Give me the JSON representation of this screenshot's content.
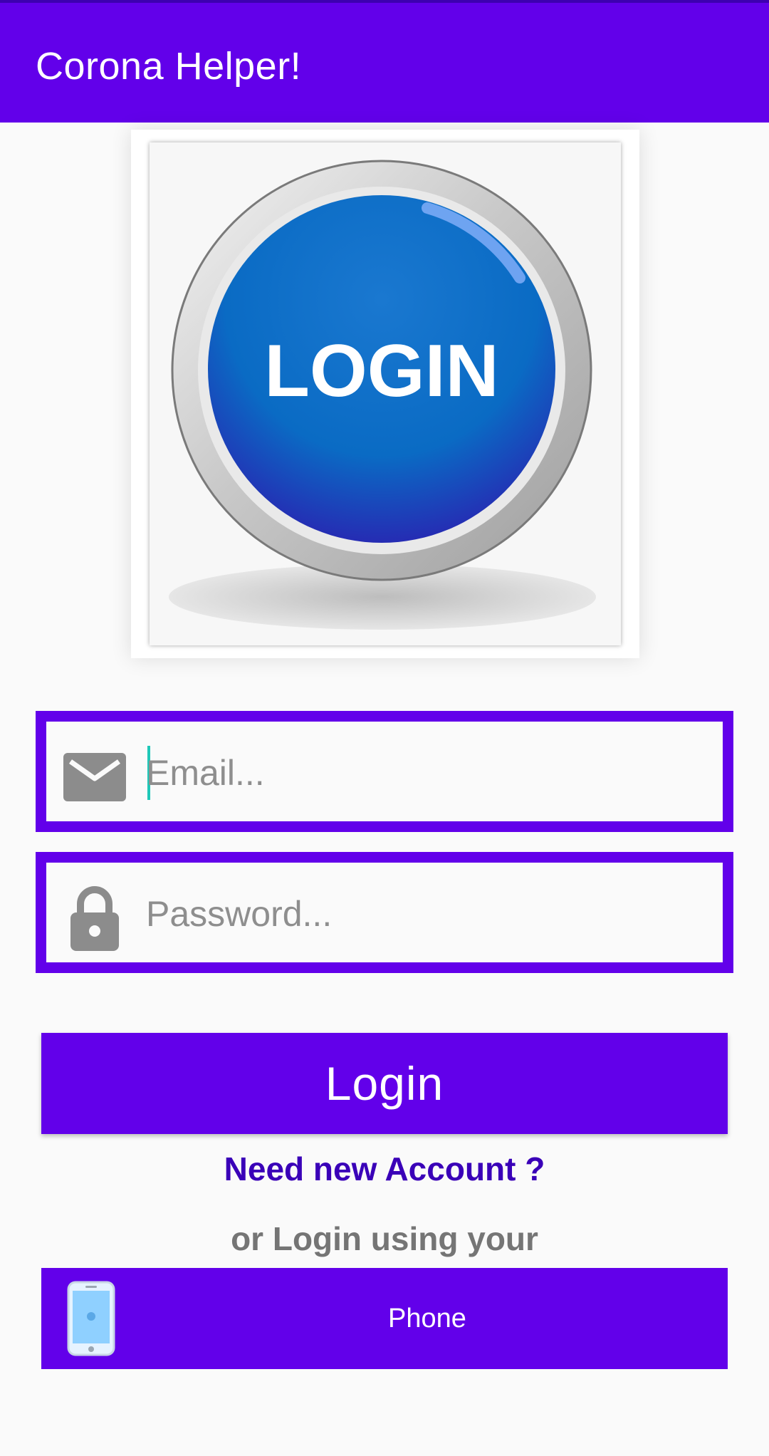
{
  "app_bar": {
    "title": "Corona Helper!"
  },
  "hero": {
    "image_text": "LOGIN"
  },
  "email_field": {
    "placeholder": "Email...",
    "value": "",
    "icon": "mail-icon"
  },
  "password_field": {
    "placeholder": "Password...",
    "value": "",
    "icon": "lock-icon"
  },
  "login_button": {
    "label": "Login"
  },
  "links": {
    "new_account": "Need new Account ?",
    "or_login": "or Login using your"
  },
  "phone_button": {
    "label": "Phone",
    "icon": "phone-icon"
  },
  "colors": {
    "primary": "#6200ea",
    "link": "#3a00b8",
    "muted_text": "#757575",
    "caret": "#1ec8b8"
  }
}
